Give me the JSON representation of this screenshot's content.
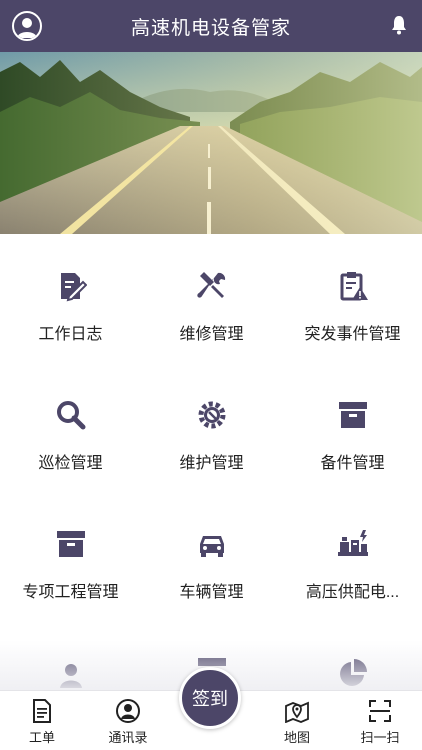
{
  "header": {
    "title": "高速机电设备管家"
  },
  "grid": {
    "items": [
      {
        "label": "工作日志",
        "icon": "edit-document-icon"
      },
      {
        "label": "维修管理",
        "icon": "tools-icon"
      },
      {
        "label": "突发事件管理",
        "icon": "clipboard-warning-icon"
      },
      {
        "label": "巡检管理",
        "icon": "magnifier-icon"
      },
      {
        "label": "维护管理",
        "icon": "gear-wrench-icon"
      },
      {
        "label": "备件管理",
        "icon": "archive-box-icon"
      },
      {
        "label": "专项工程管理",
        "icon": "archive-box-icon"
      },
      {
        "label": "车辆管理",
        "icon": "car-icon"
      },
      {
        "label": "高压供配电...",
        "icon": "power-equipment-icon"
      }
    ]
  },
  "tabbar": {
    "work_order": "工单",
    "contacts": "通讯录",
    "sign_in": "签到",
    "map": "地图",
    "scan": "扫一扫"
  },
  "colors": {
    "primary": "#4c4668",
    "icon": "#4c4668"
  }
}
